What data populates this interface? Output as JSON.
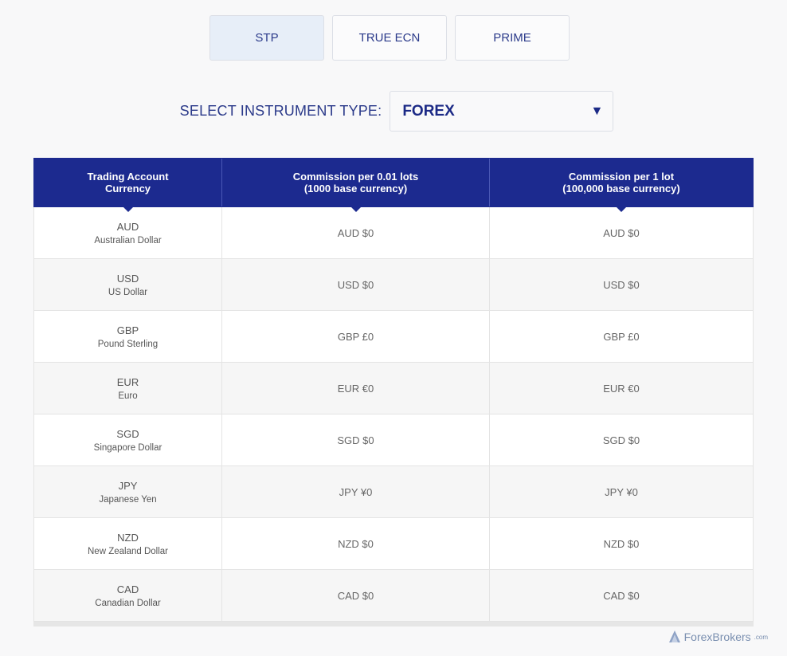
{
  "tabs": [
    {
      "label": "STP",
      "active": true
    },
    {
      "label": "TRUE ECN",
      "active": false
    },
    {
      "label": "PRIME",
      "active": false
    }
  ],
  "instrument": {
    "label": "SELECT INSTRUMENT TYPE:",
    "value": "FOREX",
    "arrow": "▼"
  },
  "table": {
    "headers": [
      "Trading Account\nCurrency",
      "Commission per 0.01 lots\n(1000 base currency)",
      "Commission per 1 lot\n(100,000 base currency)"
    ],
    "rows": [
      {
        "code": "AUD",
        "name": "Australian Dollar",
        "c1": "AUD $0",
        "c2": "AUD $0"
      },
      {
        "code": "USD",
        "name": "US Dollar",
        "c1": "USD $0",
        "c2": "USD $0"
      },
      {
        "code": "GBP",
        "name": "Pound Sterling",
        "c1": "GBP £0",
        "c2": "GBP £0"
      },
      {
        "code": "EUR",
        "name": "Euro",
        "c1": "EUR €0",
        "c2": "EUR €0"
      },
      {
        "code": "SGD",
        "name": "Singapore Dollar",
        "c1": "SGD $0",
        "c2": "SGD $0"
      },
      {
        "code": "JPY",
        "name": "Japanese Yen",
        "c1": "JPY ¥0",
        "c2": "JPY ¥0"
      },
      {
        "code": "NZD",
        "name": "New Zealand Dollar",
        "c1": "NZD $0",
        "c2": "NZD $0"
      },
      {
        "code": "CAD",
        "name": "Canadian Dollar",
        "c1": "CAD $0",
        "c2": "CAD $0"
      }
    ]
  },
  "watermark": {
    "brand": "ForexBrokers",
    "suffix": ".com",
    "icon": "forexbrokers-logo-icon"
  },
  "colors": {
    "accent": "#1c2a8f",
    "tab_active": "#e7eef8",
    "text_blue": "#2b3a8a"
  }
}
